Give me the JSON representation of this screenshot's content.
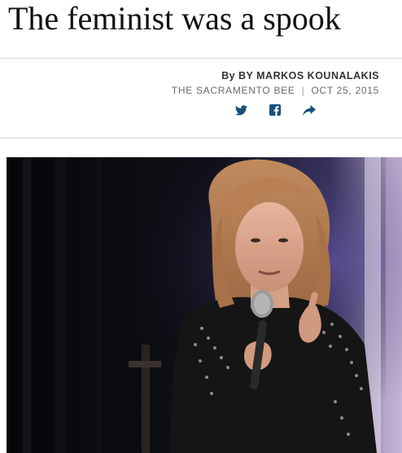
{
  "article": {
    "headline": "The feminist was a spook",
    "byline": "By BY MARKOS KOUNALAKIS",
    "source": "THE SACRAMENTO BEE",
    "separator": "|",
    "date": "OCT 25, 2015"
  },
  "share": [
    {
      "name": "twitter",
      "icon": "twitter-icon"
    },
    {
      "name": "facebook",
      "icon": "facebook-icon"
    },
    {
      "name": "share",
      "icon": "share-arrow-icon"
    }
  ],
  "colors": {
    "accent": "#1a4f7a",
    "headline": "#111111",
    "meta": "#6b6b6b"
  }
}
